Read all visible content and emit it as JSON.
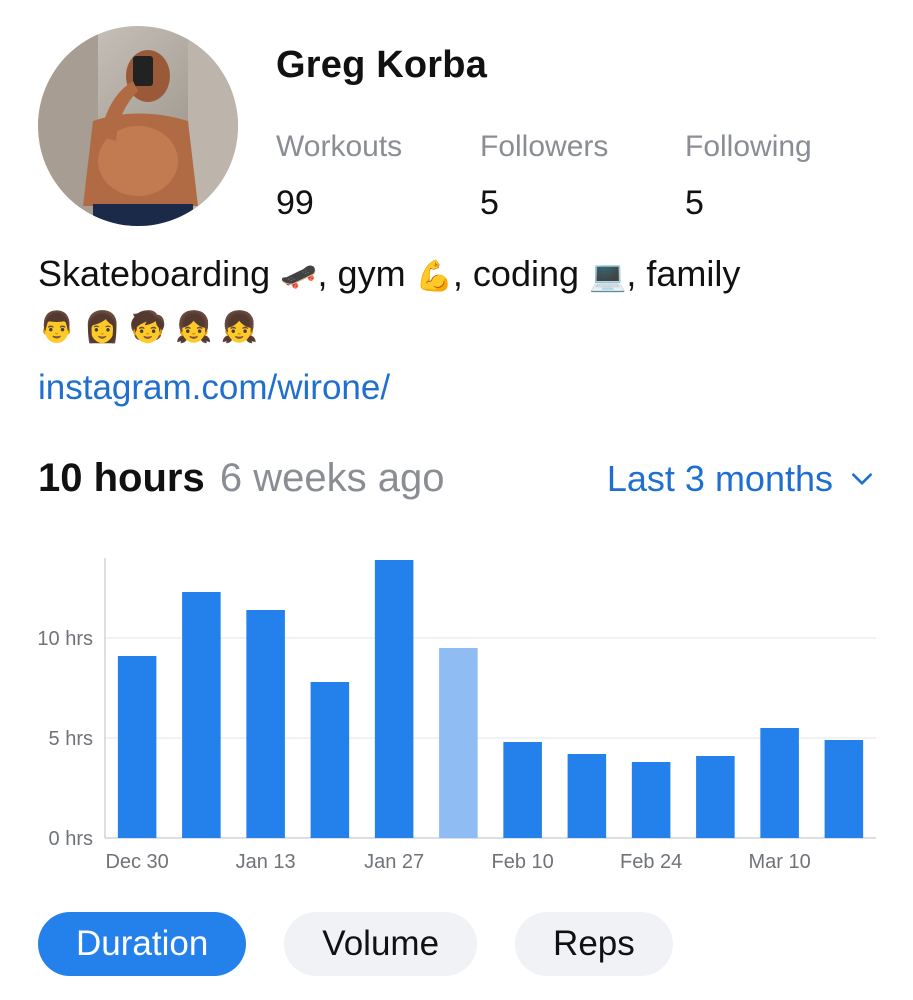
{
  "profile": {
    "name": "Greg Korba",
    "stats": [
      {
        "label": "Workouts",
        "value": "99"
      },
      {
        "label": "Followers",
        "value": "5"
      },
      {
        "label": "Following",
        "value": "5"
      }
    ],
    "bio": {
      "line_text_1": "Skateboarding ",
      "emoji_skateboard": "🛹",
      "line_text_2": ", gym ",
      "emoji_muscle": "💪",
      "line_text_3": ", coding ",
      "emoji_laptop": "💻",
      "line_text_4": ", family ",
      "family_emojis": "👨 👩 🧒 👧 👧"
    },
    "link": "instagram.com/wirone/"
  },
  "summary": {
    "total": "10 hours",
    "since": "6 weeks ago",
    "range_label": "Last 3 months"
  },
  "chart_data": {
    "type": "bar",
    "categories": [
      "Dec 30",
      "",
      "Jan 13",
      "",
      "Jan 27",
      "",
      "Feb 10",
      "",
      "Feb 24",
      "",
      "Mar 10",
      ""
    ],
    "values": [
      9.1,
      12.3,
      11.4,
      7.8,
      13.9,
      9.5,
      4.8,
      4.2,
      3.8,
      4.1,
      5.5,
      4.9
    ],
    "highlight_index": 5,
    "ylim": [
      0,
      14
    ],
    "y_ticks": [
      0,
      5,
      10
    ],
    "y_tick_labels": [
      "0 hrs",
      "5 hrs",
      "10 hrs"
    ],
    "bar_color": "#2480ea",
    "highlight_color": "#8fbcf2",
    "grid": true
  },
  "tabs": [
    {
      "label": "Duration",
      "active": true
    },
    {
      "label": "Volume",
      "active": false
    },
    {
      "label": "Reps",
      "active": false
    }
  ]
}
